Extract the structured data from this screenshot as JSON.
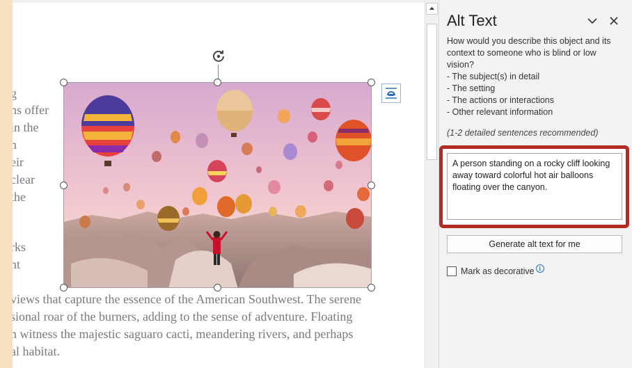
{
  "document": {
    "left_fragments": [
      "g",
      "ns offer",
      "in the",
      "n",
      "eir",
      "clear",
      "the",
      "rks",
      "nt"
    ],
    "bottom_lines": [
      "views that capture the essence of the American Southwest. The serene",
      "sional roar of the burners, adding to the sense of adventure. Floating",
      "n witness the majestic saguaro cacti, meandering rivers, and perhaps",
      "al habitat."
    ]
  },
  "image": {
    "subject": "hot air balloons over rocky canyon with person in red jacket",
    "icons": {
      "rotate": "rotate-handle-icon",
      "layout": "layout-options-icon"
    }
  },
  "pane": {
    "title": "Alt Text",
    "description_lines": [
      "How would you describe this object and its context to someone who is blind or low vision?",
      "- The subject(s) in detail",
      "- The setting",
      "- The actions or interactions",
      "- Other relevant information"
    ],
    "recommendation": "(1-2 detailed sentences recommended)",
    "alt_text_value": "A person standing on a rocky cliff looking away toward colorful hot air balloons floating over the canyon.",
    "generate_label": "Generate alt text for me",
    "decorative_label": "Mark as decorative",
    "icons": {
      "collapse": "chevron-down-icon",
      "close": "close-icon",
      "info": "info-icon"
    }
  },
  "colors": {
    "highlight": "#b52a22",
    "pane_bg": "#f3f3f3",
    "info": "#1a73c8"
  }
}
